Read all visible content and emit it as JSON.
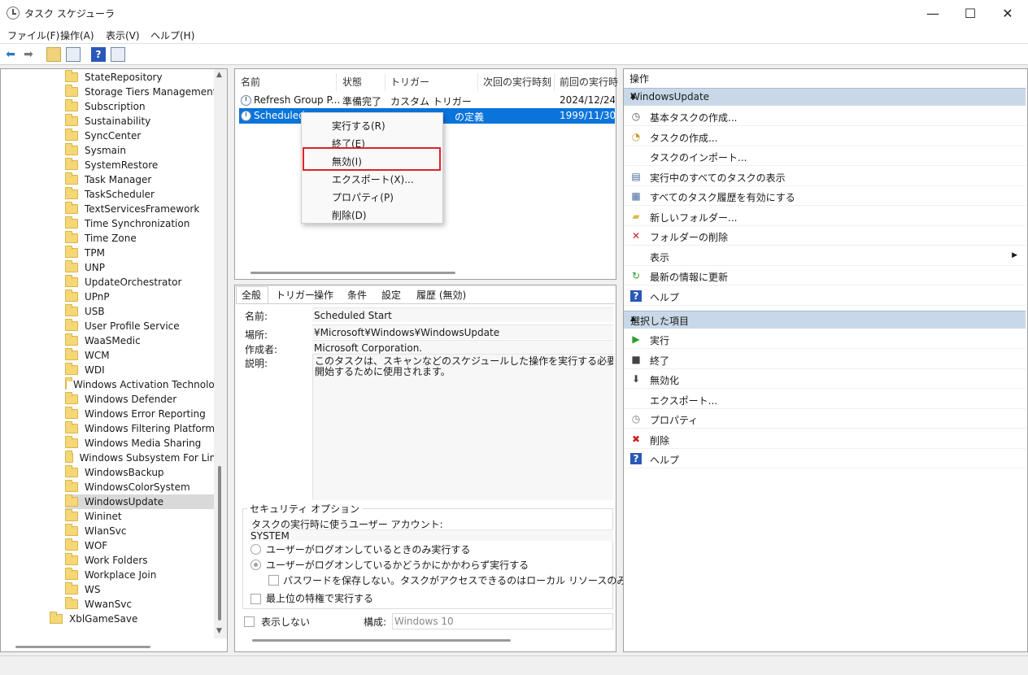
{
  "window": {
    "title": "タスク スケジューラ",
    "minimize": "—",
    "maximize": "☐",
    "close": "✕"
  },
  "menu": [
    "ファイル(F)",
    "操作(A)",
    "表示(V)",
    "ヘルプ(H)"
  ],
  "tree": {
    "items": [
      "StateRepository",
      "Storage Tiers Management",
      "Subscription",
      "Sustainability",
      "SyncCenter",
      "Sysmain",
      "SystemRestore",
      "Task Manager",
      "TaskScheduler",
      "TextServicesFramework",
      "Time Synchronization",
      "Time Zone",
      "TPM",
      "UNP",
      "UpdateOrchestrator",
      "UPnP",
      "USB",
      "User Profile Service",
      "WaaSMedic",
      "WCM",
      "WDI",
      "Windows Activation Technologies",
      "Windows Defender",
      "Windows Error Reporting",
      "Windows Filtering Platform",
      "Windows Media Sharing",
      "Windows Subsystem For Linux",
      "WindowsBackup",
      "WindowsColorSystem",
      "WindowsUpdate",
      "Wininet",
      "WlanSvc",
      "WOF",
      "Work Folders",
      "Workplace Join",
      "WS",
      "WwanSvc"
    ],
    "selected": "WindowsUpdate",
    "root_item": "XblGameSave"
  },
  "task_list": {
    "columns": [
      "名前",
      "状態",
      "トリガー",
      "次回の実行時刻",
      "前回の実行時"
    ],
    "rows": [
      {
        "name": "Refresh Group P...",
        "status": "準備完了",
        "trigger": "カスタム トリガー",
        "next": "",
        "last": "2024/12/24 2"
      },
      {
        "name": "Scheduled",
        "status": "",
        "trigger": "の定義",
        "next": "",
        "last": "1999/11/30 0"
      }
    ]
  },
  "context_menu": [
    "実行する(R)",
    "終了(E)",
    "無効(I)",
    "エクスポート(X)...",
    "プロパティ(P)",
    "削除(D)"
  ],
  "details": {
    "tabs": [
      "全般",
      "トリガー",
      "操作",
      "条件",
      "設定",
      "履歴 (無効)"
    ],
    "name_label": "名前:",
    "name_value": "Scheduled Start",
    "location_label": "場所:",
    "location_value": "¥Microsoft¥Windows¥WindowsUpdate",
    "author_label": "作成者:",
    "author_value": "Microsoft Corporation.",
    "desc_label": "説明:",
    "desc_value_1": "このタスクは、スキャンなどのスケジュールした操作を実行する必要がある場合に",
    "desc_value_2": "開始するために使用されます。",
    "security_title": "セキュリティ オプション",
    "account_label": "タスクの実行時に使うユーザー アカウント:",
    "account_value": "SYSTEM",
    "radio_1": "ユーザーがログオンしているときのみ実行する",
    "radio_2": "ユーザーがログオンしているかどうかにかかわらず実行する",
    "check_nopass": "パスワードを保存しない。タスクがアクセスできるのはローカル リソースのみ",
    "check_highest": "最上位の特権で実行する",
    "hidden_label": "表示しない",
    "config_label": "構成:",
    "config_value": "Windows 10"
  },
  "actions": {
    "header": "操作",
    "section1": "WindowsUpdate",
    "items1": [
      {
        "icon": "basic-task-icon",
        "label": "基本タスクの作成..."
      },
      {
        "icon": "create-task-icon",
        "label": "タスクの作成..."
      },
      {
        "icon": "import-icon",
        "label": "タスクのインポート..."
      },
      {
        "icon": "running-tasks-icon",
        "label": "実行中のすべてのタスクの表示"
      },
      {
        "icon": "history-icon",
        "label": "すべてのタスク履歴を有効にする"
      },
      {
        "icon": "new-folder-icon",
        "label": "新しいフォルダー..."
      },
      {
        "icon": "delete-folder-icon",
        "label": "フォルダーの削除"
      },
      {
        "icon": "view-icon",
        "label": "表示"
      },
      {
        "icon": "refresh-icon",
        "label": "最新の情報に更新"
      },
      {
        "icon": "help-icon",
        "label": "ヘルプ"
      }
    ],
    "section2": "選択した項目",
    "items2": [
      {
        "icon": "run-icon",
        "label": "実行"
      },
      {
        "icon": "stop-icon",
        "label": "終了"
      },
      {
        "icon": "disable-icon",
        "label": "無効化"
      },
      {
        "icon": "export-icon",
        "label": "エクスポート..."
      },
      {
        "icon": "properties-icon",
        "label": "プロパティ"
      },
      {
        "icon": "delete-icon",
        "label": "削除"
      },
      {
        "icon": "help-icon",
        "label": "ヘルプ"
      }
    ]
  }
}
